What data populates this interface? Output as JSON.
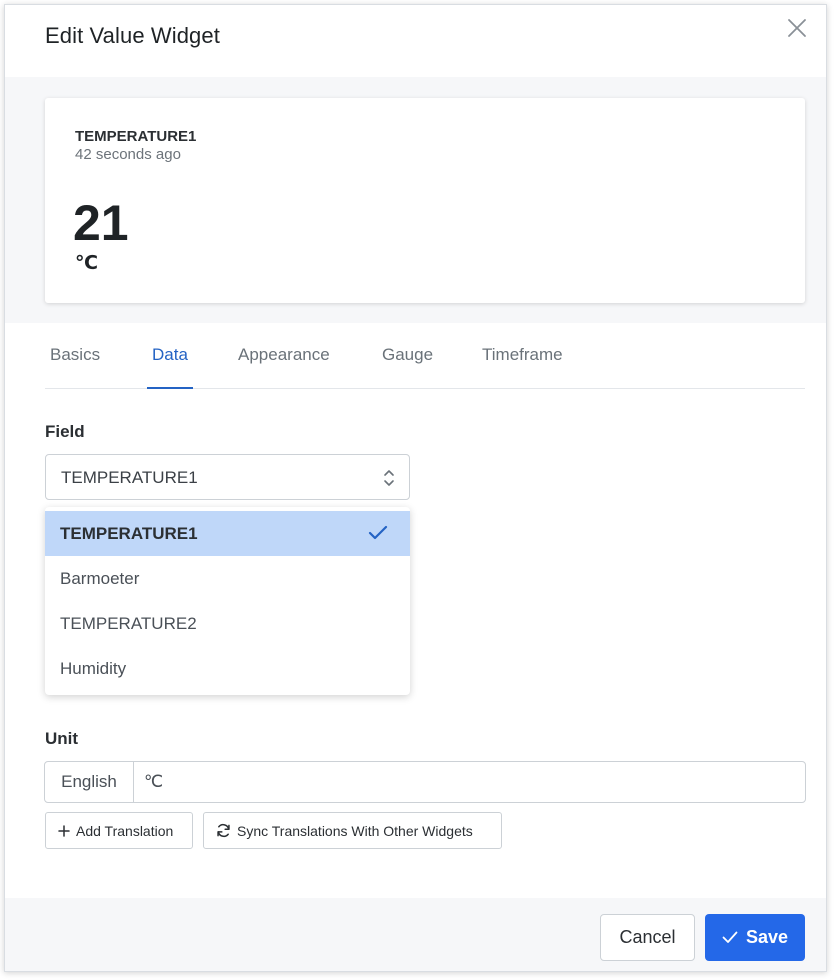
{
  "modal": {
    "title": "Edit Value Widget"
  },
  "preview": {
    "field": "TEMPERATURE1",
    "time_ago": "42 seconds ago",
    "value": "21",
    "unit": "℃"
  },
  "tabs": [
    {
      "label": "Basics",
      "active": false
    },
    {
      "label": "Data",
      "active": true
    },
    {
      "label": "Appearance",
      "active": false
    },
    {
      "label": "Gauge",
      "active": false
    },
    {
      "label": "Timeframe",
      "active": false
    }
  ],
  "field": {
    "label": "Field",
    "selected": "TEMPERATURE1",
    "options": [
      "TEMPERATURE1",
      "Barmoeter",
      "TEMPERATURE2",
      "Humidity"
    ]
  },
  "unit": {
    "label": "Unit",
    "language": "English",
    "value": "℃"
  },
  "actions": {
    "add_translation": "Add Translation",
    "sync_translations": "Sync Translations With Other Widgets",
    "cancel": "Cancel",
    "save": "Save"
  },
  "colors": {
    "accent": "#2468e8",
    "active_tab": "#2463c4",
    "selected_option_bg": "#bfd7f9"
  }
}
